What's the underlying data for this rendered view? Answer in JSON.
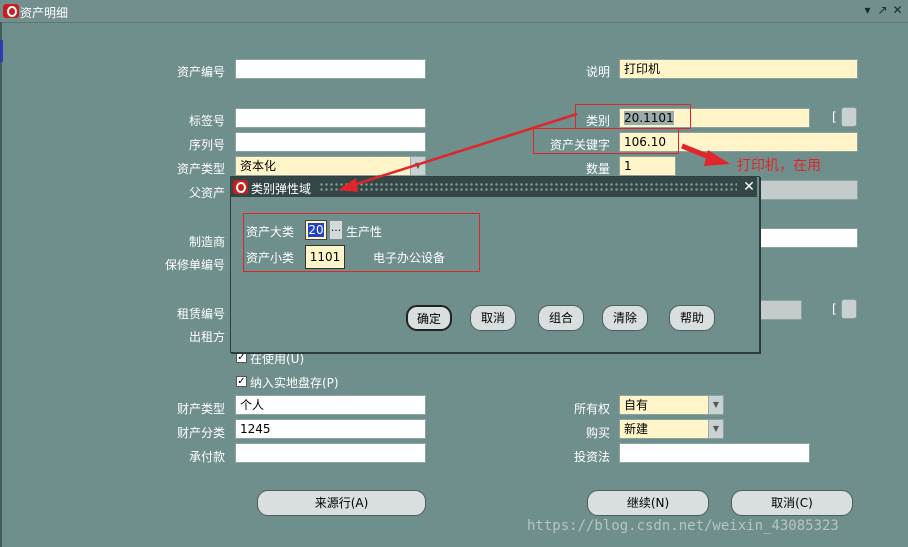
{
  "window": {
    "title": "资产明细"
  },
  "dialog": {
    "title": "类别弹性域",
    "major_label": "资产大类",
    "major_value": "20",
    "major_desc": "生产性",
    "minor_label": "资产小类",
    "minor_value": "1101",
    "minor_desc": "电子办公设备",
    "buttons": {
      "ok": "确定",
      "cancel": "取消",
      "combine": "组合",
      "clear": "清除",
      "help": "帮助"
    }
  },
  "form": {
    "asset_number_label": "资产编号",
    "asset_number": "",
    "description_label": "说明",
    "description": "打印机",
    "tag_label": "标签号",
    "tag": "",
    "category_label": "类别",
    "category": "20.1101",
    "serial_label": "序列号",
    "serial": "",
    "asset_key_label": "资产关键字",
    "asset_key": "106.10",
    "asset_type_label": "资产类型",
    "asset_type": "资本化",
    "quantity_label": "数量",
    "quantity": "1",
    "parent_label": "父资产",
    "manufacturer_label": "制造商",
    "warranty_label": "保修单编号",
    "lease_label": "租赁编号",
    "lessor_label": "出租方",
    "in_use_label": "在使用(U)",
    "in_use_checked": true,
    "physical_inventory_label": "纳入实地盘存(P)",
    "physical_inventory_checked": true,
    "property_type_label": "财产类型",
    "property_type": "个人",
    "ownership_label": "所有权",
    "ownership": "自有",
    "property_class_label": "财产分类",
    "property_class": "1245",
    "bought_label": "购买",
    "bought": "新建",
    "commitment_label": "承付款",
    "commitment": "",
    "investment_law_label": "投资法",
    "investment_law": ""
  },
  "buttons": {
    "source_lines": "来源行(A)",
    "continue": "继续(N)",
    "cancel": "取消(C)"
  },
  "annotation": {
    "text": "打印机，在用"
  },
  "watermark": "https://blog.csdn.net/weixin_43085323",
  "colors": {
    "background": "#6f8f8c",
    "required_field": "#fff5c8",
    "annotation": "#e0262a"
  }
}
